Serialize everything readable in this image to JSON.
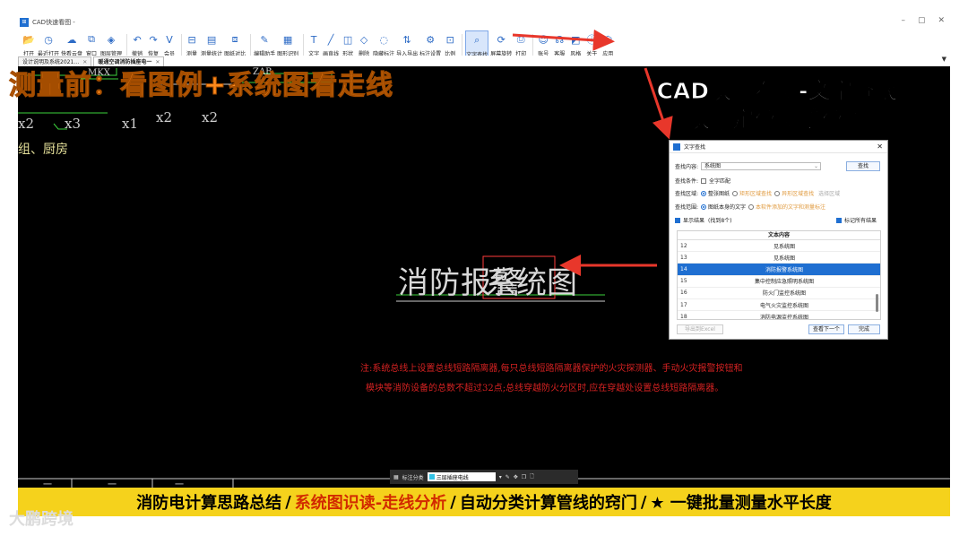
{
  "window": {
    "title": "CAD快速看图 -",
    "controls": [
      "–",
      "▢",
      "✕"
    ]
  },
  "ribbon": [
    {
      "label": "打开",
      "icon": "open-folder-icon",
      "glyph": "📂"
    },
    {
      "label": "最近打开",
      "icon": "recent-icon",
      "glyph": "◷"
    },
    {
      "label": "快看云盘",
      "icon": "cloud-icon",
      "glyph": "☁"
    },
    {
      "label": "窗口",
      "icon": "window-icon",
      "glyph": "⧉"
    },
    {
      "label": "图层管理",
      "icon": "layers-icon",
      "glyph": "◈"
    },
    {
      "label": "撤销",
      "icon": "undo-icon",
      "glyph": "↶"
    },
    {
      "label": "恢复",
      "icon": "redo-icon",
      "glyph": "↷"
    },
    {
      "label": "会员",
      "icon": "vip-icon",
      "glyph": "V"
    },
    {
      "label": "测量",
      "icon": "measure-icon",
      "glyph": "⊟"
    },
    {
      "label": "测量统计",
      "icon": "measure-stats-icon",
      "glyph": "▤"
    },
    {
      "label": "图纸对比",
      "icon": "compare-icon",
      "glyph": "⧈"
    },
    {
      "label": "编辑助手",
      "icon": "edit-assistant-icon",
      "glyph": "✎"
    },
    {
      "label": "图形识别",
      "icon": "shape-recognize-icon",
      "glyph": "▦"
    },
    {
      "label": "文字",
      "icon": "text-icon",
      "glyph": "T"
    },
    {
      "label": "画直线",
      "icon": "line-icon",
      "glyph": "╱"
    },
    {
      "label": "形状",
      "icon": "shape-icon",
      "glyph": "◫"
    },
    {
      "label": "删除",
      "icon": "eraser-icon",
      "glyph": "◇"
    },
    {
      "label": "隐藏标注",
      "icon": "hide-annotation-icon",
      "glyph": "◌"
    },
    {
      "label": "导入导出",
      "icon": "import-export-icon",
      "glyph": "⇅"
    },
    {
      "label": "标注设置",
      "icon": "annotation-settings-icon",
      "glyph": "⚙"
    },
    {
      "label": "比例",
      "icon": "scale-icon",
      "glyph": "⊡"
    },
    {
      "label": "文字查找",
      "icon": "text-search-icon",
      "glyph": "⌕",
      "active": true
    },
    {
      "label": "屏幕旋转",
      "icon": "rotate-screen-icon",
      "glyph": "⟳"
    },
    {
      "label": "打印",
      "icon": "print-icon",
      "glyph": "⎙"
    },
    {
      "label": "账号",
      "icon": "account-icon",
      "glyph": "☺"
    },
    {
      "label": "客服",
      "icon": "support-icon",
      "glyph": "☊"
    },
    {
      "label": "风格",
      "icon": "style-icon",
      "glyph": "◩"
    },
    {
      "label": "关于",
      "icon": "about-icon",
      "glyph": "ⓘ"
    },
    {
      "label": "应用",
      "icon": "apps-icon",
      "glyph": "⬡"
    }
  ],
  "tabs": [
    {
      "label": "设计说明及系统2021…",
      "active": false
    },
    {
      "label": "暖通空调消防插座电一",
      "active": true
    }
  ],
  "canvas": {
    "fragments": [
      "MKX",
      "ZAB",
      "x2",
      "x3",
      "x1",
      "x2",
      "x2",
      "组、厨房"
    ],
    "title_text_a": "消防报警",
    "title_text_b": "系统图",
    "note_line1": "注:系统总线上设置总线短路隔离器,每只总线短路隔离器保护的火灾探测器、手动火灾报警按钮和",
    "note_line2": "模块等消防设备的总数不超过32点;总线穿越防火分区时,应在穿越处设置总线短路隔离器。",
    "bottom_fragments": [
      "一",
      "一",
      "一"
    ]
  },
  "overlay": {
    "headline_left": "测量前：看图例+系统图看走线",
    "headline_right_1": "CAD快速看图-文字查找",
    "headline_right_2": "快速定位图纸位置"
  },
  "dialog": {
    "title": "文字查找",
    "content_label": "查找内容:",
    "content_value": "系统图",
    "search_button": "查找",
    "condition_label": "查找条件:",
    "full_match": "全字匹配",
    "area_label": "查找区域:",
    "area_opt1": "整张图纸",
    "area_opt2": "矩形区域查找",
    "area_opt3": "异形区域查找",
    "area_select": "选择区域",
    "scope_label": "查找范围:",
    "scope_opt1": "图纸本身的文字",
    "scope_opt2": "本软件添加的文字和测量标注",
    "show_results": "显示结果",
    "found_count": "(找到8个)",
    "mark_all": "标记所有结果",
    "table_header": "文本内容",
    "rows": [
      {
        "n": "12",
        "t": "见系统图",
        "selected": false
      },
      {
        "n": "13",
        "t": "见系统图",
        "selected": false
      },
      {
        "n": "14",
        "t": "消防报警系统图",
        "selected": true
      },
      {
        "n": "15",
        "t": "集中控制应急照明系统图",
        "selected": false
      },
      {
        "n": "16",
        "t": "防火门监控系统图",
        "selected": false
      },
      {
        "n": "17",
        "t": "电气火灾监控系统图",
        "selected": false
      },
      {
        "n": "18",
        "t": "消防电源监控系统图",
        "selected": false
      }
    ],
    "export_button": "导出到Excel",
    "next_button": "查看下一个",
    "done_button": "完成"
  },
  "bottom_toolbar": {
    "label": "标注分类",
    "selected": "三层插座电线"
  },
  "caption": {
    "part1": "消防电计算思路总结",
    "part2": "系统图识读-走线分析",
    "part3": "自动分类计算管线的窍门",
    "part4": "★ 一键批量测量水平长度"
  },
  "watermark": "大鹏跨境",
  "colors": {
    "accent": "#1f6fd1",
    "headline": "#ff8a1c",
    "arrow": "#e8372b",
    "caption_bg": "#f5d21c",
    "caption_highlight": "#d22a00"
  }
}
